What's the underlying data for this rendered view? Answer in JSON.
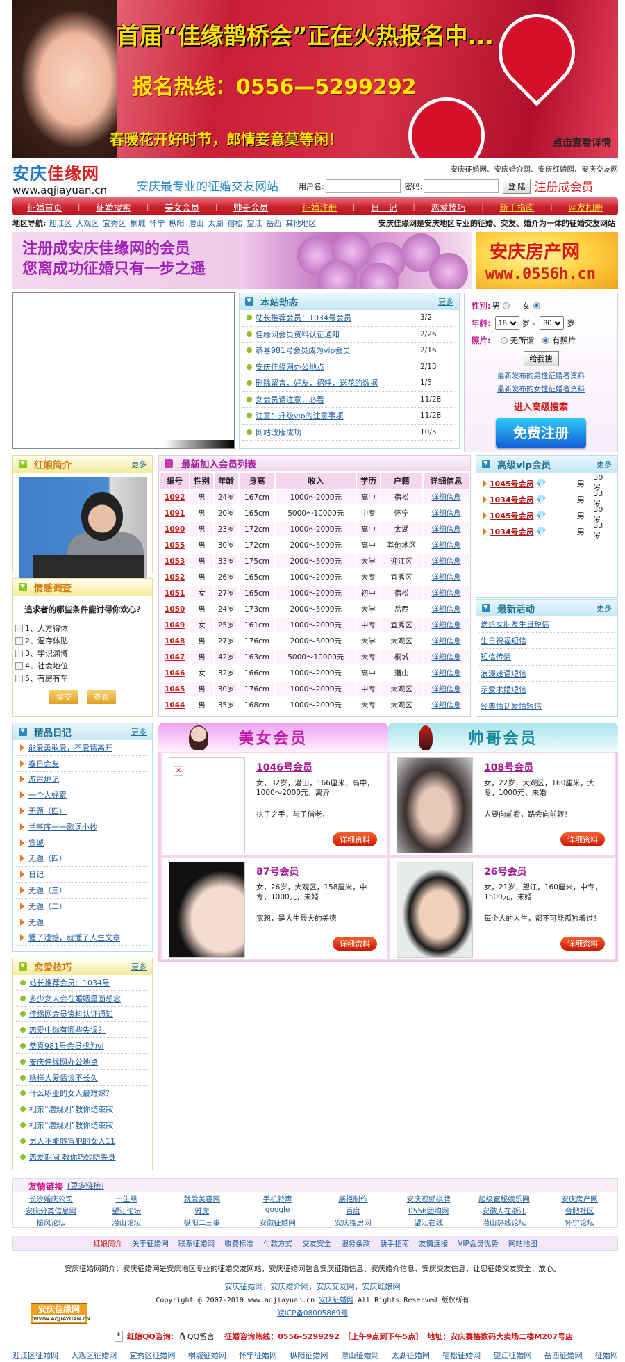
{
  "banner": {
    "headline": "首届“佳缘鹊桥会”正在火热报名中...",
    "hotline": "报名热线：0556—5299292",
    "slogan": "春暖花开好时节，郎情妾意莫等闲！",
    "link": "点击查看详情"
  },
  "header": {
    "logo_cn_a": "安庆",
    "logo_cn_b": "佳缘网",
    "logo_url": "www.aqjiayuan.cn",
    "slogan": "安庆最专业的征婚交友网站",
    "top_links": "安庆征婚网、安庆婚介网、安庆红娘网、安庆交友网",
    "username_label": "用户名:",
    "username_value": "",
    "password_label": "密码:",
    "password_value": "",
    "login_button": "登 陆",
    "register_link": "注册成会员"
  },
  "nav": [
    {
      "label": "征婚首页"
    },
    {
      "label": "征婚搜索"
    },
    {
      "label": "美女会员"
    },
    {
      "label": "帅哥会员"
    },
    {
      "label": "征婚注册",
      "hl": true
    },
    {
      "label": "日　记"
    },
    {
      "label": "恋爱技巧"
    },
    {
      "label": "新手指南",
      "hl": true
    },
    {
      "label": "网友相册",
      "hl": true
    }
  ],
  "region": {
    "label": "地区导航:",
    "items": [
      "迎江区",
      "大观区",
      "宜秀区",
      "桐城",
      "怀宁",
      "枞阳",
      "潜山",
      "太湖",
      "宿松",
      "望江",
      "岳西",
      "其他地区"
    ],
    "tagline": "安庆佳缘网是安庆地区专业的征婚、交友、婚介为一体的征婚交友网站"
  },
  "ads": {
    "left_line1": "注册成安庆佳缘网的会员",
    "left_line2": "您离成功征婚只有一步之遥",
    "right_title": "安庆房产网",
    "right_url": "www.0556h.cn"
  },
  "news": {
    "title": "本站动态",
    "more": "更多",
    "items": [
      {
        "t": "站长推荐会员：1034号会员",
        "d": "3/2"
      },
      {
        "t": "佳缘网会员资料认证通知",
        "d": "2/26"
      },
      {
        "t": "恭喜981号会员成为vip会员",
        "d": "2/16"
      },
      {
        "t": "安庆佳缘网办公地点",
        "d": "2/13"
      },
      {
        "t": "删除留言，好友，招呼，送花的数据",
        "d": "1/5"
      },
      {
        "t": "女会员请注意，必看",
        "d": "11/28"
      },
      {
        "t": "注意：升级vip的注意事项",
        "d": "11/28"
      },
      {
        "t": "网站改版成功",
        "d": "10/5"
      }
    ]
  },
  "search": {
    "gender_label": "性别:",
    "male": "男",
    "female": "女",
    "gender_selected": "女",
    "age_label": "年龄:",
    "age_from": "18",
    "age_to": "30",
    "age_unit": "岁",
    "dash": "-",
    "photo_label": "照片:",
    "photo_any": "无所谓",
    "photo_yes": "有照片",
    "photo_selected": "有照片",
    "search_button": "给我搜",
    "latest_male": "最新发布的男性征婚者资料",
    "latest_female": "最新发布的女性征婚者资料",
    "advanced": "进入高级搜索",
    "free_register": "免费注册"
  },
  "matchmaker": {
    "title": "红娘简介",
    "more": "更多"
  },
  "survey": {
    "title": "情感调查",
    "question": "追求者的哪些条件能讨得你欢心?",
    "options": [
      "1、大方得体",
      "2、温存体贴",
      "3、学识渊博",
      "4、社会地位",
      "5、有房有车"
    ],
    "submit": "提交",
    "view": "查看"
  },
  "members": {
    "title": "最新加入会员列表",
    "columns": [
      "编号",
      "性别",
      "年龄",
      "身高",
      "收入",
      "学历",
      "户籍",
      "详细信息"
    ],
    "rows": [
      [
        "1092",
        "男",
        "24岁",
        "167cm",
        "1000～2000元",
        "高中",
        "宿松",
        "详细信息"
      ],
      [
        "1091",
        "男",
        "20岁",
        "165cm",
        "5000～10000元",
        "中专",
        "怀宁",
        "详细信息"
      ],
      [
        "1090",
        "男",
        "23岁",
        "172cm",
        "1000～2000元",
        "高中",
        "太湖",
        "详细信息"
      ],
      [
        "1055",
        "男",
        "30岁",
        "172cm",
        "2000～5000元",
        "高中",
        "其他地区",
        "详细信息"
      ],
      [
        "1053",
        "男",
        "33岁",
        "175cm",
        "2000～5000元",
        "大学",
        "迎江区",
        "详细信息"
      ],
      [
        "1052",
        "男",
        "26岁",
        "165cm",
        "1000～2000元",
        "大专",
        "宜秀区",
        "详细信息"
      ],
      [
        "1051",
        "女",
        "27岁",
        "165cm",
        "1000～2000元",
        "初中",
        "宿松",
        "详细信息"
      ],
      [
        "1050",
        "男",
        "24岁",
        "173cm",
        "2000～5000元",
        "大学",
        "岳西",
        "详细信息"
      ],
      [
        "1049",
        "女",
        "25岁",
        "161cm",
        "1000～2000元",
        "中专",
        "宜秀区",
        "详细信息"
      ],
      [
        "1048",
        "男",
        "27岁",
        "176cm",
        "2000～5000元",
        "大学",
        "大观区",
        "详细信息"
      ],
      [
        "1047",
        "男",
        "42岁",
        "163cm",
        "5000～10000元",
        "大专",
        "桐城",
        "详细信息"
      ],
      [
        "1046",
        "女",
        "32岁",
        "166cm",
        "1000～2000元",
        "高中",
        "潜山",
        "详细信息"
      ],
      [
        "1045",
        "男",
        "30岁",
        "176cm",
        "1000～2000元",
        "中专",
        "大观区",
        "详细信息"
      ],
      [
        "1044",
        "男",
        "35岁",
        "168cm",
        "1000～2000元",
        "大专",
        "大观区",
        "详细信息"
      ]
    ]
  },
  "vip": {
    "title": "高级vip会员",
    "more": "更多",
    "items": [
      {
        "id": "1045号会员",
        "sex": "男",
        "age": "30岁"
      },
      {
        "id": "1034号会员",
        "sex": "男",
        "age": "33岁"
      },
      {
        "id": "1045号会员",
        "sex": "男",
        "age": "30岁"
      },
      {
        "id": "1034号会员",
        "sex": "男",
        "age": "33岁"
      }
    ]
  },
  "activities": {
    "title": "最新活动",
    "more": "更多",
    "items": [
      "送给女朋友生日短信",
      "生日祝福短信",
      "短信传情",
      "浪漫迷语短信",
      "示爱求婚短信",
      "经典情话爱情短信"
    ]
  },
  "diary": {
    "title": "精品日记",
    "more": "更多",
    "items": [
      "能爱勇敢爱，不爱请离开",
      "春日会友",
      "游古炉记",
      "一个人好累",
      "无题（四）",
      "兰亭序一一歌词小抄",
      "宣城",
      "无题（四）",
      "日记",
      "无题（三）",
      "无题（二）",
      "无题",
      "懂了遗憾，就懂了人生文章"
    ]
  },
  "tips": {
    "title": "恋爱技巧",
    "more": "更多",
    "items": [
      "站长推荐会员：1034号",
      "多少女人会在婚姻里面想念",
      "佳缘网会员资料认证通知",
      "恋爱中你有哪些失误？",
      "恭喜981号会员成为vi",
      "安庆佳缘网办公地点",
      "啥样人爱情谈不长久",
      "什么职业的女人最难嫁？",
      "相亲“潜规则”教你结束寂",
      "相亲“潜规则”教你结束寂",
      "男人不能够冒犯的女人11",
      "恋爱期间 教你巧妙防失身"
    ]
  },
  "showcase": {
    "female_tab": "美女会员",
    "male_tab": "帅哥会员",
    "detail_button": "详细资料",
    "cards": [
      {
        "name": "1046号会员",
        "info": "女，32岁，潜山，166厘米，高中，1000～2000元，离异",
        "motto": "执子之手，与子偕老，",
        "photo": "broken"
      },
      {
        "name": "108号会员",
        "info": "女，22岁，大观区，160厘米，大专，1000元，未婚",
        "motto": "人要向前看，路会向前转！",
        "photo": "ok"
      },
      {
        "name": "87号会员",
        "info": "女，26岁，大观区，158厘米，中专，1000元，未婚",
        "motto": "宽恕，是人生最大的美德",
        "photo": "ok"
      },
      {
        "name": "26号会员",
        "info": "女，21岁，望江，160厘米，中专，1500元，未婚",
        "motto": "每个人的人生，都不可能孤独着过！",
        "photo": "ok"
      }
    ]
  },
  "friend_links": {
    "title": "友情链接",
    "more": "[更多链接]",
    "items": [
      "长沙婚庆公司",
      "一生缘",
      "就爱美容网",
      "手机铃声",
      "展柜制作",
      "安庆视频棋牌",
      "超级蜜秘娱乐网",
      "安庆房产网",
      "安庆分类信息网",
      "望江论坛",
      "雅虎",
      "google",
      "百度",
      "0556团购网",
      "安徽人在浙江",
      "合肥社区",
      "振风论坛",
      "潜山论坛",
      "枞阳二三事",
      "安徽征婚网",
      "安庆搜房网",
      "望江在线",
      "潜山热线论坛",
      "怀宁论坛"
    ]
  },
  "footer": {
    "nav": [
      "红娘简介",
      "关于征婚网",
      "联系征婚网",
      "收费标准",
      "付款方式",
      "交友安全",
      "服务条款",
      "新手指南",
      "友情连接",
      "VIP会员优势",
      "网站地图"
    ],
    "intro": "安庆征婚网简介：安庆征婚网是安庆地区专业的征婚交友网站，安庆征婚网包含安庆征婚信息、安庆婚介信息、安庆交友信息，让您征婚交友安全，放心。",
    "links": [
      "安庆征婚网",
      "安庆婚介网",
      "安庆交友网",
      "安庆红娘网"
    ],
    "link_sep": "，",
    "copyright_pre": "Copyright @ 2007-2010 www.aqjiayuan.cn ",
    "copyright_link": "安庆征婚网",
    "copyright_post": " All Rights Reserved 版权所有",
    "icp": "皖ICP备08005869号",
    "logo_text": "安庆佳缘网",
    "logo_url": "WWW.AQJIAYUAN.CN",
    "qq_label": "红娘QQ咨询:",
    "qq_msg": "QQ留言",
    "hotline": "征婚咨询热线：0556-5299292",
    "hours": "［上午9点到下午5点］",
    "address": "地址：安庆赛格数码大卖场二楼M207号店",
    "cities": [
      "迎江区征婚网",
      "大观区征婚网",
      "宜秀区征婚网",
      "桐城征婚网",
      "怀宁征婚网",
      "枞阳征婚网",
      "潜山征婚网",
      "太湖征婚网",
      "宿松征婚网",
      "望江征婚网",
      "岳西征婚网",
      "征婚网"
    ]
  }
}
